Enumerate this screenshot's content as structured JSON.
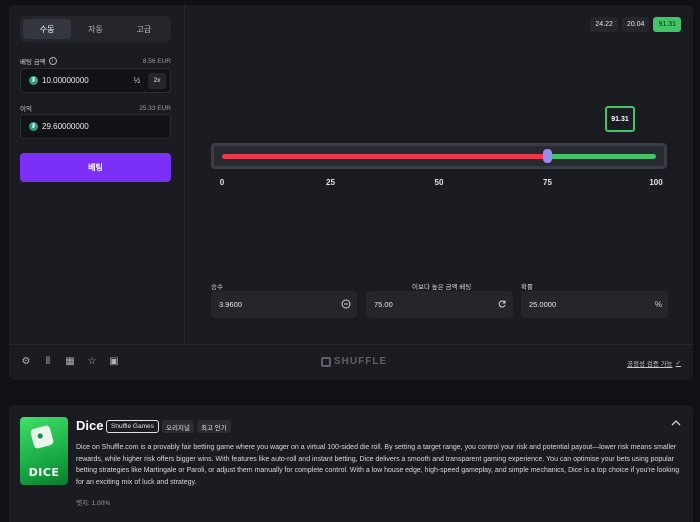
{
  "mode_tabs": [
    {
      "label": "수동",
      "active": true
    },
    {
      "label": "자동",
      "active": false
    },
    {
      "label": "고급",
      "active": false
    }
  ],
  "bet_amount": {
    "label": "베팅 금액",
    "converted": "8.56 EUR",
    "value": "10.00000000",
    "half_label": "½",
    "double_label": "2x"
  },
  "profit": {
    "label": "이익",
    "converted": "25.33 EUR",
    "value": "29.60000000"
  },
  "bet_button": "베팅",
  "history": [
    {
      "value": "24.22",
      "win": false
    },
    {
      "value": "20.04",
      "win": false
    },
    {
      "value": "91.31",
      "win": true
    }
  ],
  "slider": {
    "min": 0,
    "max": 100,
    "threshold": 75,
    "result": "91.31",
    "scale_labels": [
      "0",
      "25",
      "50",
      "75",
      "100"
    ],
    "colors": {
      "lose": "#e8384b",
      "win": "#43c36a",
      "thumb": "#9b8af0"
    }
  },
  "stats": {
    "multiplier": {
      "label": "승수",
      "value": "3.9600",
      "icon": "x-circle-icon"
    },
    "roll_over": {
      "label": "이보다 높은 금액 베팅",
      "value": "75.00",
      "icon": "refresh-icon"
    },
    "win_chance": {
      "label": "확률",
      "value": "25.0000",
      "icon_text": "%"
    }
  },
  "footer": {
    "icons": [
      "settings-icon",
      "stats-icon",
      "chart-icon",
      "star-icon",
      "briefcase-icon"
    ],
    "logo": "SHUFFLE",
    "fairness_link": "공정성 검증 가능"
  },
  "game_info": {
    "title": "Dice",
    "thumb_text": "DICE",
    "tags": [
      "Shuffle Games",
      "오리지널",
      "최고 인기"
    ],
    "description": "Dice on Shuffle.com is a provably fair betting game where you wager on a virtual 100-sided die roll. By setting a target range, you control your risk and potential payout—lower risk means smaller rewards, while higher risk offers bigger wins. With features like auto-roll and instant betting, Dice delivers a smooth and transparent gaming experience. You can optimise your bets using popular betting strategies like Martingale or Paroli, or adjust them manually for complete control. With a low house edge, high-speed gameplay, and simple mechanics, Dice is a top choice if you're looking for an exciting mix of luck and strategy.",
    "edge": "엣지: 1.00%"
  },
  "accent": "#7b2ff7"
}
